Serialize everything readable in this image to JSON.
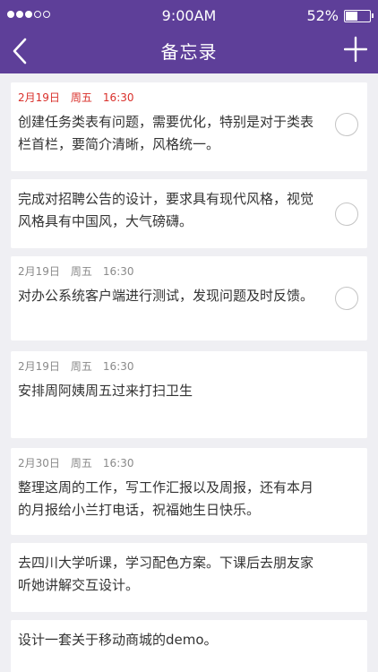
{
  "status_bar": {
    "time": "9:00AM",
    "battery_percent": "52%",
    "battery_level": 0.52
  },
  "nav": {
    "title": "备忘录"
  },
  "colors": {
    "header": "#5e3f99",
    "urgent_date": "#d9302b",
    "background": "#efeff3"
  },
  "memos": [
    {
      "date": "2月19日",
      "weekday": "周五",
      "time": "16:30",
      "urgent": true,
      "text": "创建任务类表有问题，需要优化，特别是对于类表栏首栏，要简介清晰，风格统一。",
      "has_check": true
    },
    {
      "date": "",
      "weekday": "",
      "time": "",
      "urgent": false,
      "text": "完成对招聘公告的设计，要求具有现代风格，视觉风格具有中国风，大气磅礴。",
      "has_check": true
    },
    {
      "date": "2月19日",
      "weekday": "周五",
      "time": "16:30",
      "urgent": false,
      "text": "对办公系统客户端进行测试，发现问题及时反馈。",
      "has_check": true
    },
    {
      "date": "2月19日",
      "weekday": "周五",
      "time": "16:30",
      "urgent": false,
      "text": "安排周阿姨周五过来打扫卫生",
      "has_check": false
    },
    {
      "date": "2月30日",
      "weekday": "周五",
      "time": "16:30",
      "urgent": false,
      "text": "整理这周的工作，写工作汇报以及周报，还有本月的月报给小兰打电话，祝福她生日快乐。",
      "has_check": false
    },
    {
      "date": "",
      "weekday": "",
      "time": "",
      "urgent": false,
      "text": "去四川大学听课，学习配色方案。下课后去朋友家听她讲解交互设计。",
      "has_check": false
    },
    {
      "date": "",
      "weekday": "",
      "time": "",
      "urgent": false,
      "text": "设计一套关于移动商城的demo。",
      "has_check": false
    }
  ]
}
